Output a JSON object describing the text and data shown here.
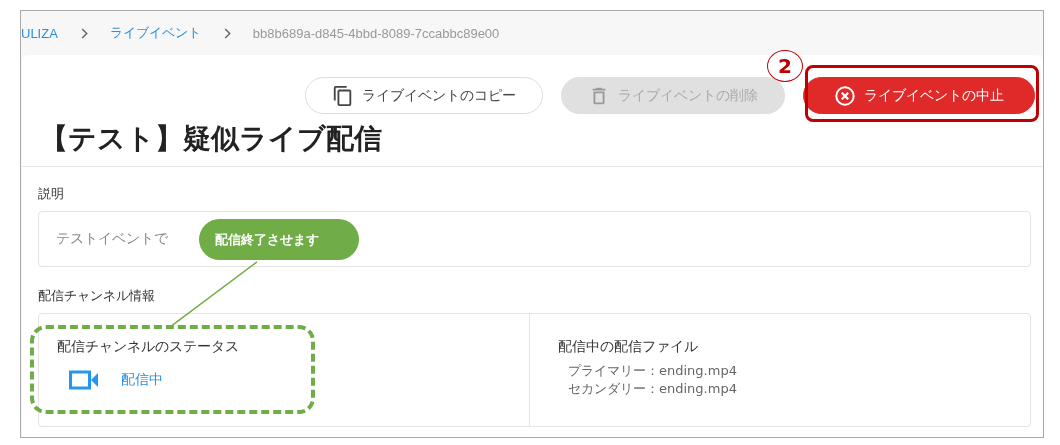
{
  "breadcrumb": [
    {
      "label": "ULIZA",
      "kind": "link"
    },
    {
      "label": "ライブイベント",
      "kind": "link"
    },
    {
      "label": "bb8b689a-d845-4bbd-8089-7ccabbc89e00",
      "kind": "current"
    }
  ],
  "actions": [
    {
      "label": "ライブイベントのコピー",
      "kind": "copy",
      "disabled": false
    },
    {
      "label": "ライブイベントの削除",
      "kind": "delete",
      "disabled": true
    },
    {
      "label": "ライブイベントの中止",
      "kind": "stop",
      "disabled": false
    }
  ],
  "title": "【テスト】疑似ライブ配信",
  "description": {
    "label": "説明",
    "value": "テストイベントで"
  },
  "channel": {
    "label": "配信チャンネル情報",
    "status_label": "配信チャンネルのステータス",
    "status": "配信中",
    "files_label": "配信中の配信ファイル",
    "files": [
      "プライマリー：ending.mp4",
      "セカンダリー：ending.mp4"
    ]
  },
  "annotations": {
    "step": "2",
    "callout": "配信終了させます"
  }
}
